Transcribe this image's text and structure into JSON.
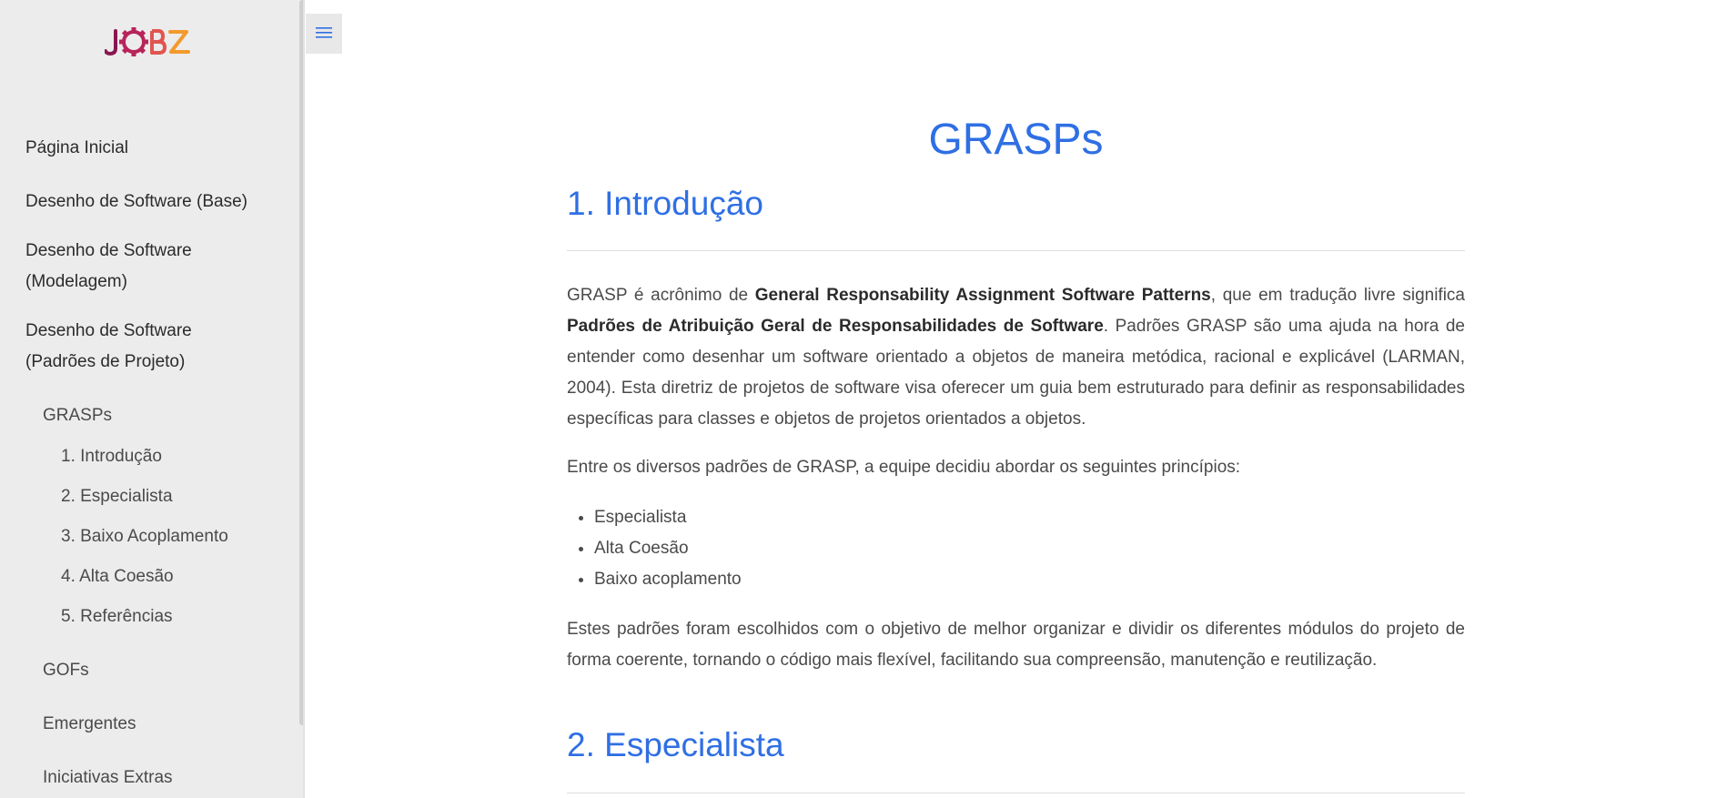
{
  "logo": {
    "text": "JOBZ"
  },
  "sidebar": {
    "items": [
      {
        "label": "Página Inicial"
      },
      {
        "label": "Desenho de Software (Base)"
      },
      {
        "label_line1": "Desenho de Software",
        "label_line2": "(Modelagem)"
      },
      {
        "label_line1": "Desenho de Software",
        "label_line2": "(Padrões de Projeto)"
      }
    ],
    "grasps": {
      "label": "GRASPs",
      "children": [
        "1. Introdução",
        "2. Especialista",
        "3. Baixo Acoplamento",
        "4. Alta Coesão",
        "5. Referências"
      ]
    },
    "gofs": "GOFs",
    "emergentes": "Emergentes",
    "iniciativas": "Iniciativas Extras"
  },
  "main": {
    "title": "GRASPs",
    "sections": [
      {
        "title": "1. Introdução"
      },
      {
        "title": "2. Especialista"
      }
    ],
    "intro": {
      "p1_a": "GRASP é acrônimo de ",
      "p1_b": "General Responsability Assignment Software Patterns",
      "p1_c": ", que em tradução livre significa ",
      "p1_d": "Padrões de Atribuição Geral de Responsabilidades de Software",
      "p1_e": ". Padrões GRASP são uma ajuda na hora de entender como desenhar um software orientado a objetos de maneira metódica, racional e explicável (LARMAN, 2004). Esta diretriz de projetos de software visa oferecer um guia bem estruturado para definir as responsabilidades específicas para classes e objetos de projetos orientados a objetos.",
      "p2": "Entre os diversos padrões de GRASP, a equipe decidiu abordar os seguintes princípios:",
      "bullets": [
        "Especialista",
        "Alta Coesão",
        "Baixo acoplamento"
      ],
      "p3": "Estes padrões foram escolhidos com o objetivo de melhor organizar e dividir os diferentes módulos do projeto de forma coerente, tornando o código mais flexível, facilitando sua compreensão, manutenção e reutilização."
    }
  },
  "colors": {
    "accent": "#2f6fe4",
    "sidebar_bg": "#ececec",
    "logo_dark": "#8a1650",
    "logo_orange": "#f39a2c"
  }
}
